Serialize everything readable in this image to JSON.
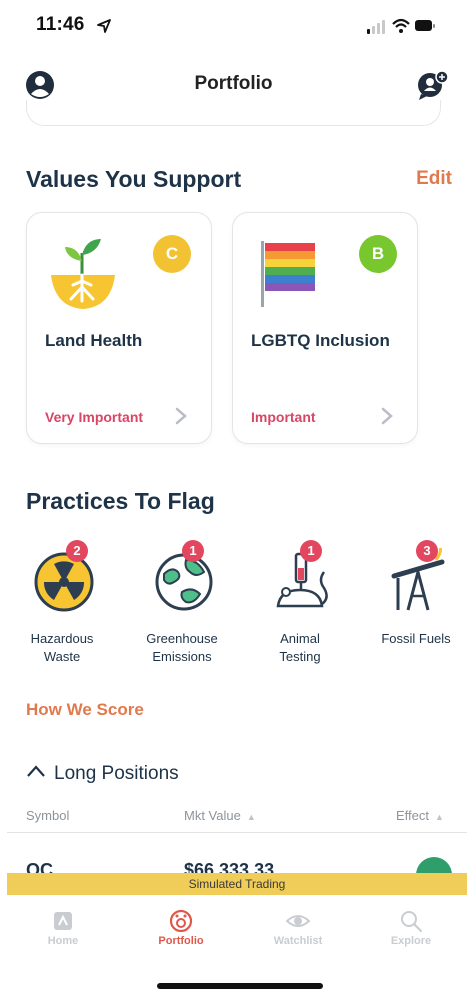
{
  "status_bar": {
    "time": "11:46"
  },
  "header": {
    "title": "Portfolio",
    "avatar_icon": "user-avatar-icon",
    "chat_icon": "chat-bubble-icon"
  },
  "values_section": {
    "title": "Values You Support",
    "edit_label": "Edit",
    "cards": [
      {
        "name": "Land Health",
        "grade": "C",
        "grade_color": "#f2c233",
        "importance": "Very Important",
        "icon": "sprout-icon"
      },
      {
        "name": "LGBTQ Inclusion",
        "grade": "B",
        "grade_color": "#79c72e",
        "importance": "Important",
        "icon": "rainbow-flag-icon"
      }
    ]
  },
  "practices_section": {
    "title": "Practices To Flag",
    "items": [
      {
        "label_line1": "Hazardous",
        "label_line2": "Waste",
        "count": "2",
        "icon": "radiation-icon"
      },
      {
        "label_line1": "Greenhouse",
        "label_line2": "Emissions",
        "count": "1",
        "icon": "globe-icon"
      },
      {
        "label_line1": "Animal",
        "label_line2": "Testing",
        "count": "1",
        "icon": "mouse-test-icon"
      },
      {
        "label_line1": "Fossil Fuels",
        "label_line2": "",
        "count": "3",
        "icon": "oil-pump-icon"
      }
    ]
  },
  "how_we_score": "How We Score",
  "positions": {
    "title": "Long Positions",
    "columns": {
      "symbol": "Symbol",
      "mkt_value": "Mkt Value",
      "effect": "Effect"
    },
    "rows": [
      {
        "symbol": "OC",
        "mkt_value": "$66,333.33"
      }
    ]
  },
  "simulated_banner": "Simulated Trading",
  "tabs": [
    {
      "label": "Home",
      "icon": "home-icon",
      "active": false
    },
    {
      "label": "Portfolio",
      "icon": "portfolio-icon",
      "active": true
    },
    {
      "label": "Watchlist",
      "icon": "eye-icon",
      "active": false
    },
    {
      "label": "Explore",
      "icon": "search-icon",
      "active": false
    }
  ],
  "colors": {
    "accent": "#e07a4d",
    "badge": "#e2475f",
    "banner": "#f0cd58",
    "text": "#1e3347",
    "positive": "#2f9e6b"
  }
}
